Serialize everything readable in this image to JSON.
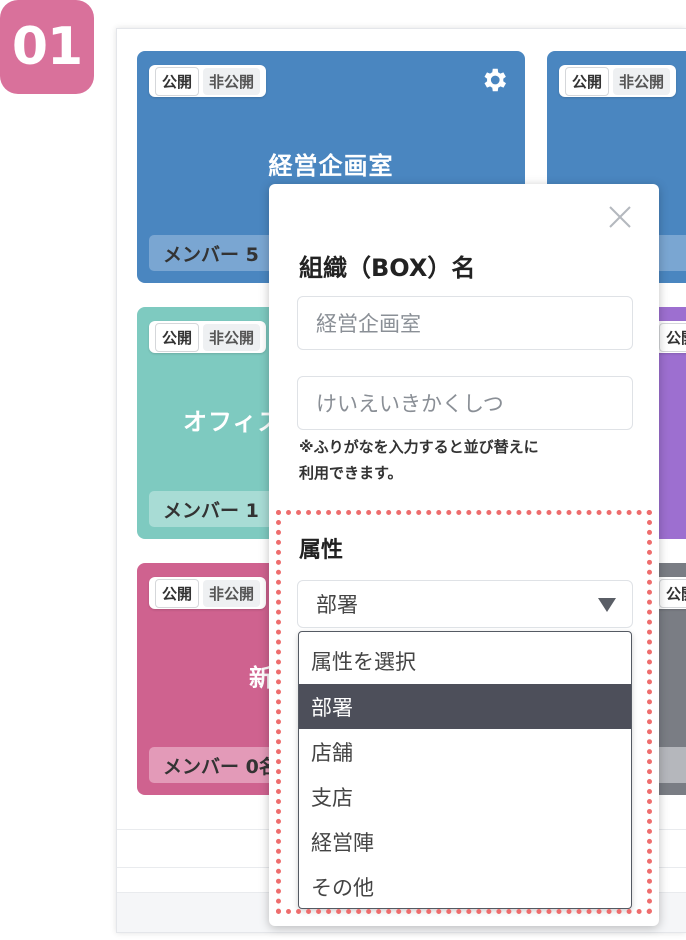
{
  "step": {
    "label": "01"
  },
  "cards": [
    {
      "id": "c1",
      "name": "経営企画室",
      "members": "メンバー 5",
      "public_label": "公開",
      "private_label": "非公開",
      "color": "#4a86c0",
      "strip": "#7aa6d2"
    },
    {
      "id": "c2",
      "name": "",
      "members": "",
      "public_label": "公開",
      "private_label": "非公開",
      "color": "#4a86c0",
      "strip": "#7aa6d2"
    },
    {
      "id": "c3",
      "name": "オフィス",
      "members": "メンバー 1",
      "public_label": "公開",
      "private_label": "非公開",
      "color": "#7ecac0",
      "strip": "#a8dcd5"
    },
    {
      "id": "c4",
      "name": "",
      "members": "",
      "public_label": "公開",
      "private_label": "",
      "color": "#9d6fd0",
      "strip": "#c0a3e0"
    },
    {
      "id": "c5",
      "name": "新",
      "members": "メンバー 0名",
      "public_label": "公開",
      "private_label": "非公開",
      "color": "#cf628f",
      "strip": "#e39ab8"
    },
    {
      "id": "c6",
      "name": "",
      "members": "",
      "public_label": "公開",
      "private_label": "",
      "color": "#7a7d84",
      "strip": "#b5b7bc"
    }
  ],
  "modal": {
    "title": "組織（BOX）名",
    "name_value": "経営企画室",
    "furigana_value": "けいえいきかくしつ",
    "hint_line1": "※ふりがなを入力すると並び替えに",
    "hint_line2": "利用できます。",
    "attr_label": "属性",
    "attr_selected": "部署",
    "options": [
      "属性を選択",
      "部署",
      "店舗",
      "支店",
      "経営陣",
      "その他"
    ]
  },
  "colors": {
    "badge": "#d9719b",
    "highlight": "#ee6d6d",
    "selected_option": "#4d4f5a"
  }
}
